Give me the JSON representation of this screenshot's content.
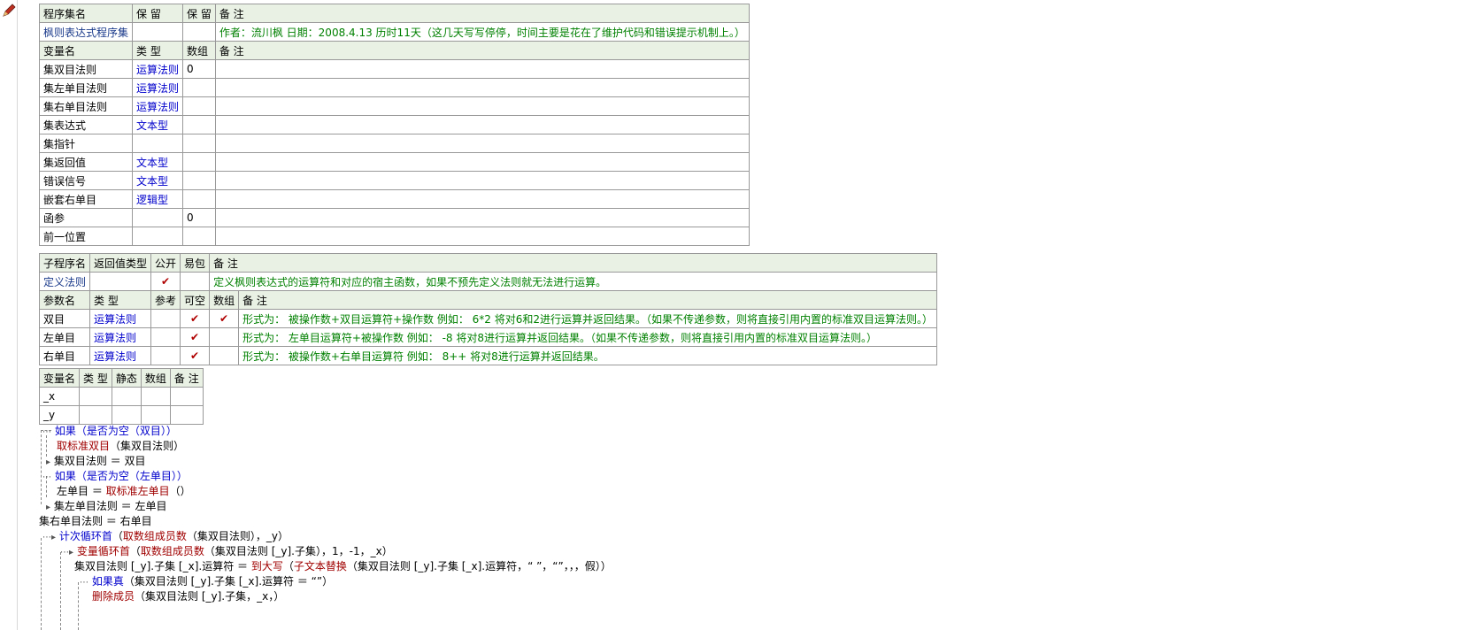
{
  "assembly": {
    "header": [
      "程序集名",
      "保 留",
      "保 留",
      "备 注"
    ],
    "row": {
      "name": "枫则表达式程序集",
      "note": "作者：流川枫 日期：2008.4.13  历时11天（这几天写写停停，时间主要是花在了维护代码和错误提示机制上。）"
    },
    "var_header": [
      "变量名",
      "类 型",
      "数组",
      "备 注"
    ],
    "vars": [
      {
        "name": "集双目法则",
        "type": "运算法则",
        "arr": "0",
        "note": ""
      },
      {
        "name": "集左单目法则",
        "type": "运算法则",
        "arr": "",
        "note": ""
      },
      {
        "name": "集右单目法则",
        "type": "运算法则",
        "arr": "",
        "note": ""
      },
      {
        "name": "集表达式",
        "type": "文本型",
        "arr": "",
        "note": ""
      },
      {
        "name": "集指针",
        "type": "",
        "arr": "",
        "note": ""
      },
      {
        "name": "集返回值",
        "type": "文本型",
        "arr": "",
        "note": ""
      },
      {
        "name": "错误信号",
        "type": "文本型",
        "arr": "",
        "note": ""
      },
      {
        "name": "嵌套右单目",
        "type": "逻辑型",
        "arr": "",
        "note": ""
      },
      {
        "name": "函参",
        "type": "",
        "arr": "0",
        "note": ""
      },
      {
        "name": "前一位置",
        "type": "",
        "arr": "",
        "note": ""
      }
    ]
  },
  "subroutine": {
    "header": [
      "子程序名",
      "返回值类型",
      "公开",
      "易包",
      "备 注"
    ],
    "row": {
      "name": "定义法则",
      "ret": "",
      "public": "✔",
      "note": "定义枫则表达式的运算符和对应的宿主函数，如果不预先定义法则就无法进行运算。"
    },
    "param_header": [
      "参数名",
      "类 型",
      "参考",
      "可空",
      "数组",
      "备 注"
    ],
    "params": [
      {
        "name": "双目",
        "type": "运算法则",
        "ref": "",
        "nullable": "✔",
        "arr": "✔",
        "note": "形式为： 被操作数+双目运算符+操作数  例如： 6*2  将对6和2进行运算并返回结果。（如果不传递参数，则将直接引用内置的标准双目运算法则。）"
      },
      {
        "name": "左单目",
        "type": "运算法则",
        "ref": "",
        "nullable": "✔",
        "arr": "",
        "note": "形式为： 左单目运算符+被操作数  例如： -8 将对8进行运算并返回结果。（如果不传递参数，则将直接引用内置的标准双目运算法则。）"
      },
      {
        "name": "右单目",
        "type": "运算法则",
        "ref": "",
        "nullable": "✔",
        "arr": "",
        "note": "形式为： 被操作数+右单目运算符  例如： 8++ 将对8进行运算并返回结果。"
      }
    ]
  },
  "locals": {
    "header": [
      "变量名",
      "类 型",
      "静态",
      "数组",
      "备 注"
    ],
    "rows": [
      {
        "name": "_x"
      },
      {
        "name": "_y"
      }
    ]
  },
  "code": {
    "l1": {
      "kw": "如果",
      "rest": "（是否为空（双目））",
      "fn": "是否为空"
    },
    "l2": {
      "fn": "取标准双目",
      "rest": "（集双目法则）"
    },
    "l3": {
      "text": "集双目法则 ＝ 双目"
    },
    "l4": {
      "kw": "如果",
      "rest": "（是否为空（左单目））"
    },
    "l5": {
      "pre": "左单目 ＝ ",
      "fn": "取标准左单目",
      "rest": "（）"
    },
    "l6": {
      "text": "集左单目法则 ＝ 左单目"
    },
    "l7": {
      "text": "集右单目法则 ＝ 右单目"
    },
    "l8": {
      "kw": "计次循环首",
      "fn": "取数组成员数",
      "rest": "（集双目法则），_y）"
    },
    "l9": {
      "kw": "变量循环首",
      "fn": "取数组成员数",
      "rest": "（集双目法则 [_y].子集），1，-1，_x）"
    },
    "l10": {
      "pre": "集双目法则 [_y].子集 [_x].运算符 ＝ ",
      "fn": "到大写",
      "mid": "（",
      "fn2": "子文本替换",
      "rest": "（集双目法则 [_y].子集 [_x].运算符，“ ”，“”，，，假））"
    },
    "l11": {
      "kw": "如果真",
      "rest": "（集双目法则 [_y].子集 [_x].运算符 ＝ “”）"
    },
    "l12": {
      "fn": "删除成员",
      "rest": "（集双目法则 [_y].子集，_x，）"
    }
  },
  "icons": {
    "pencil": "pencil-icon",
    "check": "check-icon"
  }
}
